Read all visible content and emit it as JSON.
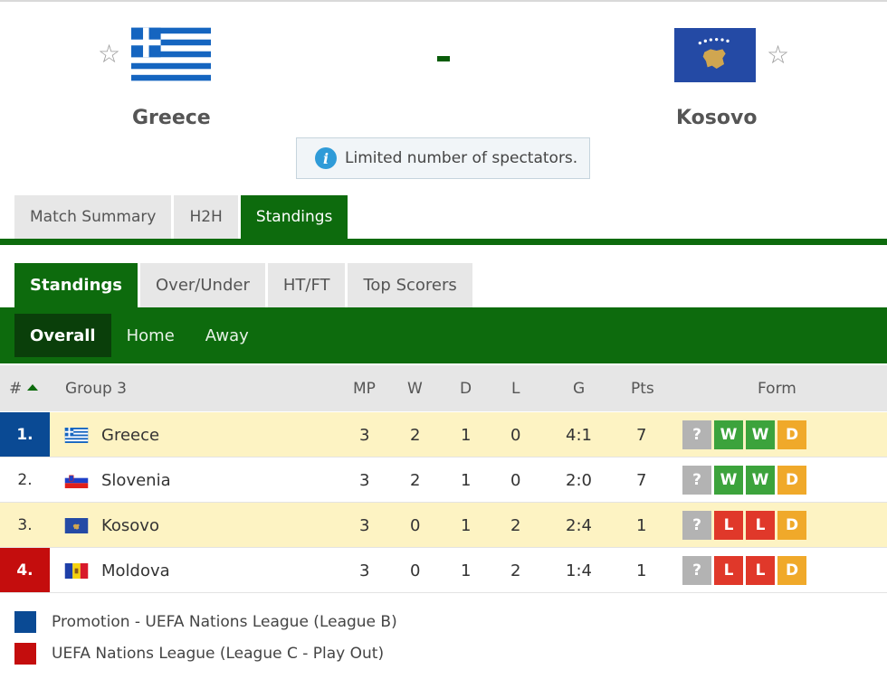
{
  "match": {
    "home": {
      "name": "Greece"
    },
    "away": {
      "name": "Kosovo"
    },
    "score": "-",
    "info": "Limited number of spectators."
  },
  "tabs": [
    {
      "label": "Match Summary",
      "active": false
    },
    {
      "label": "H2H",
      "active": false
    },
    {
      "label": "Standings",
      "active": true
    }
  ],
  "standings_tabs": [
    {
      "label": "Standings",
      "active": true
    },
    {
      "label": "Over/Under",
      "active": false
    },
    {
      "label": "HT/FT",
      "active": false
    },
    {
      "label": "Top Scorers",
      "active": false
    }
  ],
  "sub_tabs": [
    {
      "label": "Overall",
      "active": true
    },
    {
      "label": "Home",
      "active": false
    },
    {
      "label": "Away",
      "active": false
    }
  ],
  "table": {
    "headers": {
      "rank": "#",
      "group": "Group 3",
      "mp": "MP",
      "w": "W",
      "d": "D",
      "l": "L",
      "g": "G",
      "pts": "Pts",
      "form": "Form"
    },
    "rows": [
      {
        "rank": "1.",
        "team": "Greece",
        "mp": "3",
        "w": "2",
        "d": "1",
        "l": "0",
        "g": "4:1",
        "pts": "7",
        "form": [
          "?",
          "W",
          "W",
          "D"
        ]
      },
      {
        "rank": "2.",
        "team": "Slovenia",
        "mp": "3",
        "w": "2",
        "d": "1",
        "l": "0",
        "g": "2:0",
        "pts": "7",
        "form": [
          "?",
          "W",
          "W",
          "D"
        ]
      },
      {
        "rank": "3.",
        "team": "Kosovo",
        "mp": "3",
        "w": "0",
        "d": "1",
        "l": "2",
        "g": "2:4",
        "pts": "1",
        "form": [
          "?",
          "L",
          "L",
          "D"
        ]
      },
      {
        "rank": "4.",
        "team": "Moldova",
        "mp": "3",
        "w": "0",
        "d": "1",
        "l": "2",
        "g": "1:4",
        "pts": "1",
        "form": [
          "?",
          "L",
          "L",
          "D"
        ]
      }
    ]
  },
  "legend": [
    {
      "label": "Promotion - UEFA Nations League (League B)",
      "color": "#0a4a94"
    },
    {
      "label": "UEFA Nations League (League C - Play Out)",
      "color": "#c40d0d"
    }
  ],
  "colors": {
    "accent": "#0d6b0d",
    "promotion": "#0a4a94",
    "relegation": "#c40d0d",
    "highlight": "#fdf3c3"
  },
  "icons": [
    "star-icon",
    "info-icon",
    "sort-asc-icon",
    "flag-greece-icon",
    "flag-slovenia-icon",
    "flag-kosovo-icon",
    "flag-moldova-icon"
  ]
}
